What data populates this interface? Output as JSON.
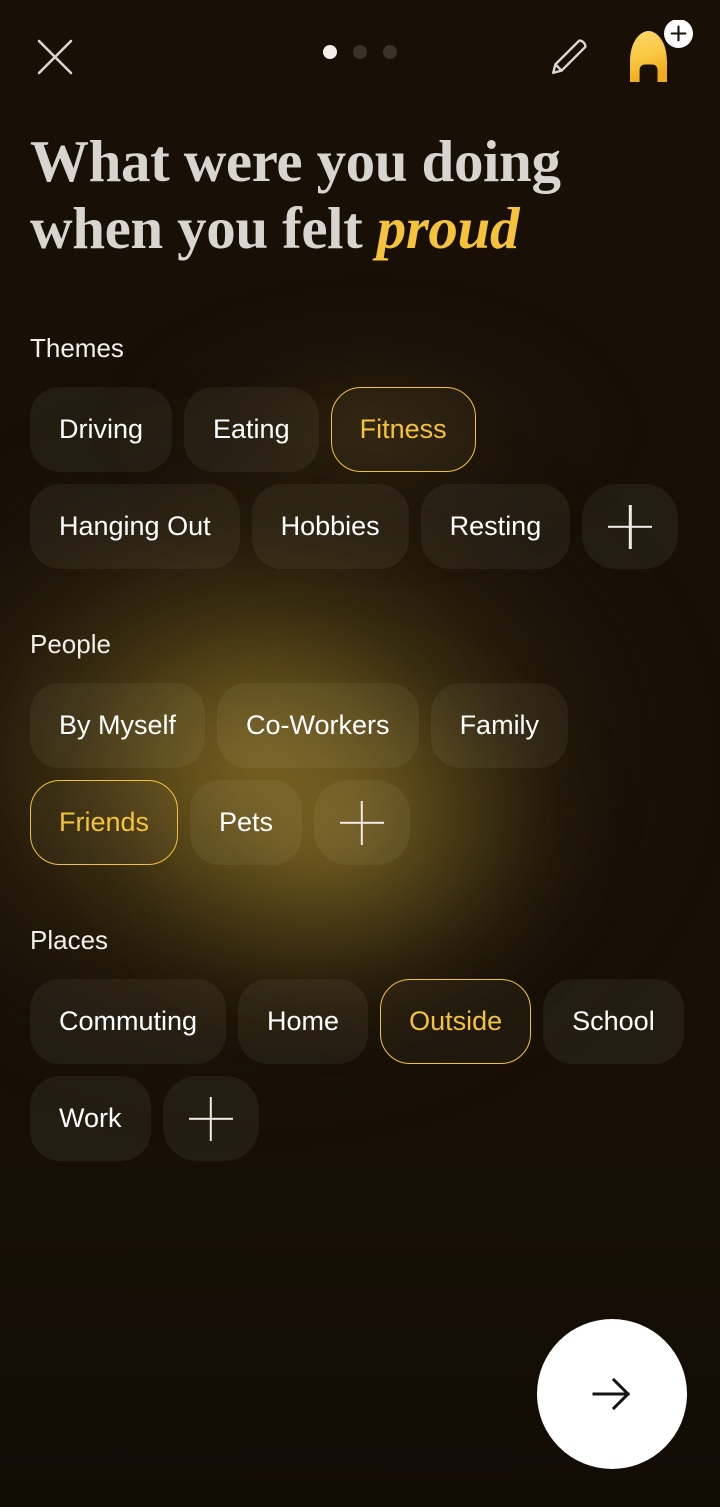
{
  "header": {
    "close_icon": "close-icon",
    "edit_icon": "pencil-icon",
    "avatar_icon": "elephant-avatar-icon",
    "avatar_badge_icon": "plus-badge-icon",
    "pager": {
      "total": 3,
      "current": 1
    }
  },
  "title": {
    "line1": "What were you doing",
    "line2_prefix": "when you felt ",
    "line2_accent": "proud"
  },
  "sections": [
    {
      "label": "Themes",
      "chips": [
        {
          "label": "Driving",
          "selected": false
        },
        {
          "label": "Eating",
          "selected": false
        },
        {
          "label": "Fitness",
          "selected": true
        },
        {
          "label": "Hanging Out",
          "selected": false
        },
        {
          "label": "Hobbies",
          "selected": false
        },
        {
          "label": "Resting",
          "selected": false
        }
      ],
      "add_label": "+"
    },
    {
      "label": "People",
      "chips": [
        {
          "label": "By Myself",
          "selected": false
        },
        {
          "label": "Co-Workers",
          "selected": false
        },
        {
          "label": "Family",
          "selected": false
        },
        {
          "label": "Friends",
          "selected": true
        },
        {
          "label": "Pets",
          "selected": false
        }
      ],
      "add_label": "+"
    },
    {
      "label": "Places",
      "chips": [
        {
          "label": "Commuting",
          "selected": false
        },
        {
          "label": "Home",
          "selected": false
        },
        {
          "label": "Outside",
          "selected": true
        },
        {
          "label": "School",
          "selected": false
        },
        {
          "label": "Work",
          "selected": false
        }
      ],
      "add_label": "+"
    }
  ],
  "next_button": {
    "icon": "arrow-right-icon"
  },
  "colors": {
    "background": "#181007",
    "accent": "#f5c33b",
    "text_primary": "#ffffff",
    "title_text": "#d8d4d0",
    "chip_fill": "rgba(255,246,226,0.055)",
    "next_button_bg": "#ffffff",
    "glow": "#806824"
  }
}
